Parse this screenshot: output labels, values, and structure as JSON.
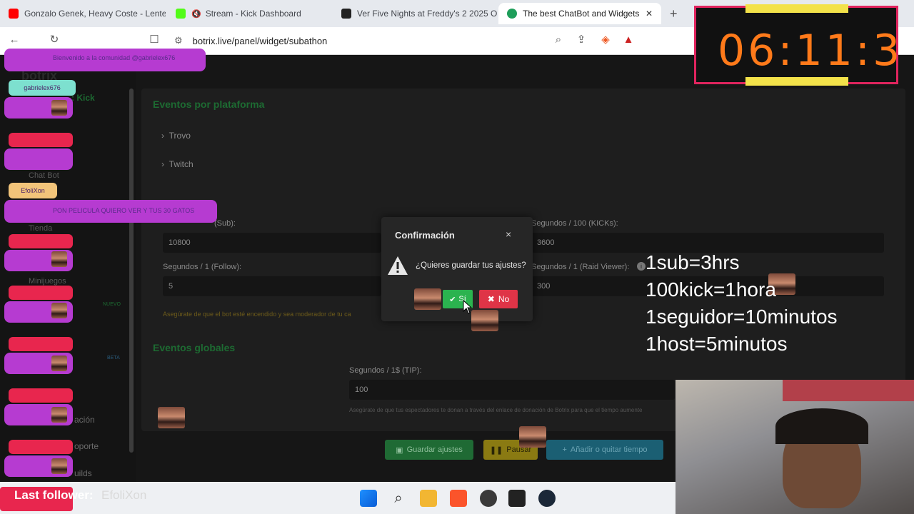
{
  "browser": {
    "tabs": [
      {
        "label": "Gonzalo Genek, Heavy Coste - Lente"
      },
      {
        "label": "Stream - Kick Dashboard"
      },
      {
        "label": "Ver Five Nights at Freddy's 2 2025 On"
      },
      {
        "label": "The best ChatBot and Widgets fo"
      }
    ],
    "url": "botrix.live/panel/widget/subathon"
  },
  "sidebar": {
    "platform_label": ": Kick",
    "items": [
      "Chat Bot",
      "Tienda",
      "Minijuegos",
      "ación",
      "oporte",
      "uilds"
    ],
    "badges": [
      "NUEVO",
      "BETA"
    ]
  },
  "panel": {
    "events_title": "Eventos por plataforma",
    "accordions": [
      "Trovo",
      "Twitch"
    ],
    "fields": {
      "sub_label": "(Sub):",
      "sub_value": "10800",
      "kicks_label": "Segundos / 100 (KICKs):",
      "kicks_value": "3600",
      "follow_label": "Segundos / 1 (Follow):",
      "follow_value": "5",
      "raid_label": "Segundos / 1 (Raid Viewer):",
      "raid_value": "300"
    },
    "bot_hint": "Asegúrate de que el bot esté encendido y sea moderador de tu ca",
    "global_title": "Eventos globales",
    "tip_label": "Segundos / 1$ (TIP):",
    "tip_value": "100",
    "tip_hint": "Asegúrate de que tus espectadores te donan a través del enlace de donación de Botrix para que el tiempo aumente",
    "buttons": {
      "save": "Guardar ajustes",
      "pause": "Pausar",
      "add_time": "Añadir o quitar tiempo"
    }
  },
  "modal": {
    "title": "Confirmación",
    "message": "¿Quieres guardar tus ajustes?",
    "yes": "Sí",
    "no": "No",
    "close": "×"
  },
  "overlay": {
    "timer": "06:11:3",
    "chat": [
      {
        "user": "",
        "msg": "Bienvenido a la comunidad @gabrielex676"
      },
      {
        "user": "gabrielex676",
        "msg": ""
      },
      {
        "user": "EfoliXon",
        "msg": "PON PELICULA QUIERO VER Y TUS 30 GATOS"
      }
    ],
    "rules": [
      "1sub=3hrs",
      "100kick=1hora",
      "1seguidor=10minutos",
      "1host=5minutos"
    ],
    "last_follower_label": "Last follower:",
    "last_follower_name": "EfoliXon"
  },
  "colors": {
    "accent_green": "#2bb34f",
    "danger_red": "#df3447",
    "timer_orange": "#ff7a1a",
    "chat_purple": "#b63bd1"
  }
}
